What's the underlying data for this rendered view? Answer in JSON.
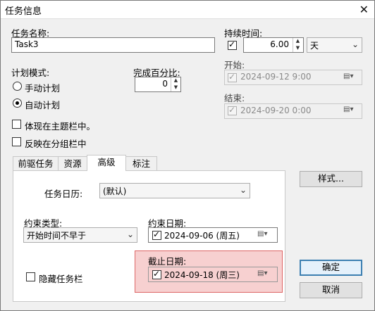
{
  "window": {
    "title": "任务信息",
    "close_icon": "close-icon"
  },
  "name": {
    "label": "任务名称:",
    "value": "Task3"
  },
  "duration": {
    "label": "持续时间:",
    "value": "6.00",
    "unit": "天",
    "checked": true
  },
  "start": {
    "label": "开始:",
    "value": "2024-09-12   9:00"
  },
  "finish": {
    "label": "结束:",
    "value": "2024-09-20   0:00"
  },
  "schedule_mode": {
    "label": "计划模式:",
    "manual": "手动计划",
    "auto": "自动计划",
    "selected": "auto"
  },
  "percent": {
    "label": "完成百分比:",
    "value": "0"
  },
  "show_in_summary": "体现在主题栏中。",
  "show_in_group": "反映在分组栏中",
  "tabs": [
    "前驱任务",
    "资源",
    "高级",
    "标注"
  ],
  "active_tab": "高级",
  "advanced": {
    "calendar_label": "任务日历:",
    "calendar_value": "(默认)",
    "constraint_type_label": "约束类型:",
    "constraint_type_value": "开始时间不早于",
    "constraint_date_label": "约束日期:",
    "constraint_date_value": "2024-09-06 (周五)",
    "deadline_label": "截止日期:",
    "deadline_value": "2024-09-18 (周三)",
    "hide_bar": "隐藏任务栏"
  },
  "buttons": {
    "style": "样式...",
    "ok": "确定",
    "cancel": "取消"
  },
  "colors": {
    "highlight": "#f7d0d0",
    "highlight_border": "#dd6666",
    "default_button_border": "#3c7fb1"
  }
}
